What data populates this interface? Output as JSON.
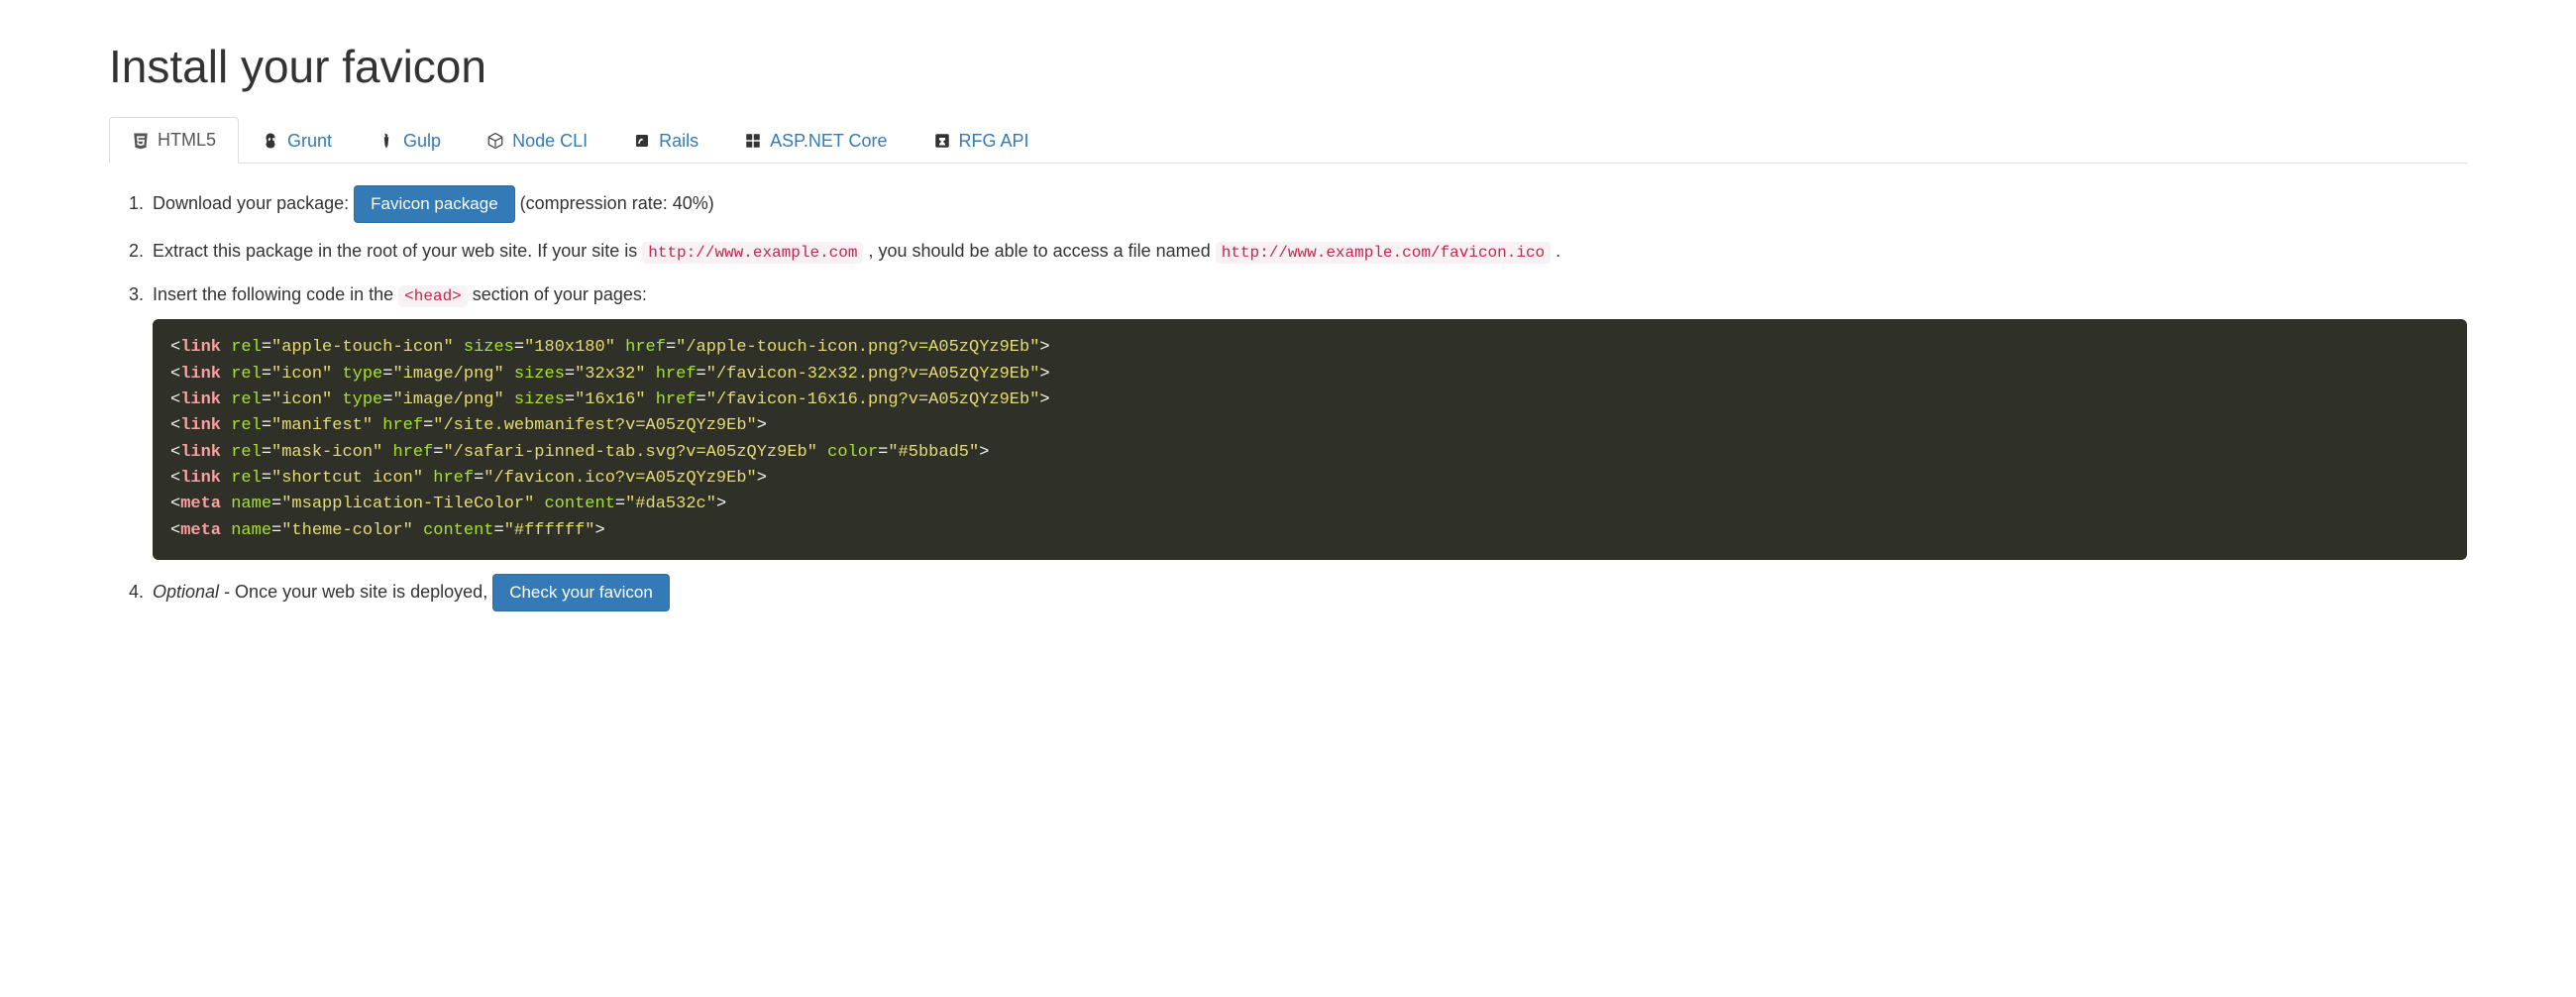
{
  "title": "Install your favicon",
  "tabs": [
    {
      "label": "HTML5"
    },
    {
      "label": "Grunt"
    },
    {
      "label": "Gulp"
    },
    {
      "label": "Node CLI"
    },
    {
      "label": "Rails"
    },
    {
      "label": "ASP.NET Core"
    },
    {
      "label": "RFG API"
    }
  ],
  "step1": {
    "prefix": "Download your package: ",
    "button": "Favicon package",
    "suffix": " (compression rate: 40%)"
  },
  "step2": {
    "prefix": "Extract this package in the root of your web site. If your site is ",
    "code1": "http://www.example.com",
    "mid": ", you should be able to access a file named ",
    "code2": "http://www.example.com/favicon.ico",
    "suffix": "."
  },
  "step3": {
    "prefix": "Insert the following code in the ",
    "code1": "<head>",
    "suffix": " section of your pages:"
  },
  "step4": {
    "optional": "Optional",
    "mid": " - Once your web site is deployed, ",
    "button": "Check your favicon"
  },
  "code_lines": [
    {
      "tag": "link",
      "attrs": [
        {
          "name": "rel",
          "value": "apple-touch-icon"
        },
        {
          "name": "sizes",
          "value": "180x180"
        },
        {
          "name": "href",
          "value": "/apple-touch-icon.png?v=A05zQYz9Eb"
        }
      ]
    },
    {
      "tag": "link",
      "attrs": [
        {
          "name": "rel",
          "value": "icon"
        },
        {
          "name": "type",
          "value": "image/png"
        },
        {
          "name": "sizes",
          "value": "32x32"
        },
        {
          "name": "href",
          "value": "/favicon-32x32.png?v=A05zQYz9Eb"
        }
      ]
    },
    {
      "tag": "link",
      "attrs": [
        {
          "name": "rel",
          "value": "icon"
        },
        {
          "name": "type",
          "value": "image/png"
        },
        {
          "name": "sizes",
          "value": "16x16"
        },
        {
          "name": "href",
          "value": "/favicon-16x16.png?v=A05zQYz9Eb"
        }
      ]
    },
    {
      "tag": "link",
      "attrs": [
        {
          "name": "rel",
          "value": "manifest"
        },
        {
          "name": "href",
          "value": "/site.webmanifest?v=A05zQYz9Eb"
        }
      ]
    },
    {
      "tag": "link",
      "attrs": [
        {
          "name": "rel",
          "value": "mask-icon"
        },
        {
          "name": "href",
          "value": "/safari-pinned-tab.svg?v=A05zQYz9Eb"
        },
        {
          "name": "color",
          "value": "#5bbad5"
        }
      ]
    },
    {
      "tag": "link",
      "attrs": [
        {
          "name": "rel",
          "value": "shortcut icon"
        },
        {
          "name": "href",
          "value": "/favicon.ico?v=A05zQYz9Eb"
        }
      ]
    },
    {
      "tag": "meta",
      "attrs": [
        {
          "name": "name",
          "value": "msapplication-TileColor"
        },
        {
          "name": "content",
          "value": "#da532c"
        }
      ]
    },
    {
      "tag": "meta",
      "attrs": [
        {
          "name": "name",
          "value": "theme-color"
        },
        {
          "name": "content",
          "value": "#ffffff"
        }
      ]
    }
  ]
}
